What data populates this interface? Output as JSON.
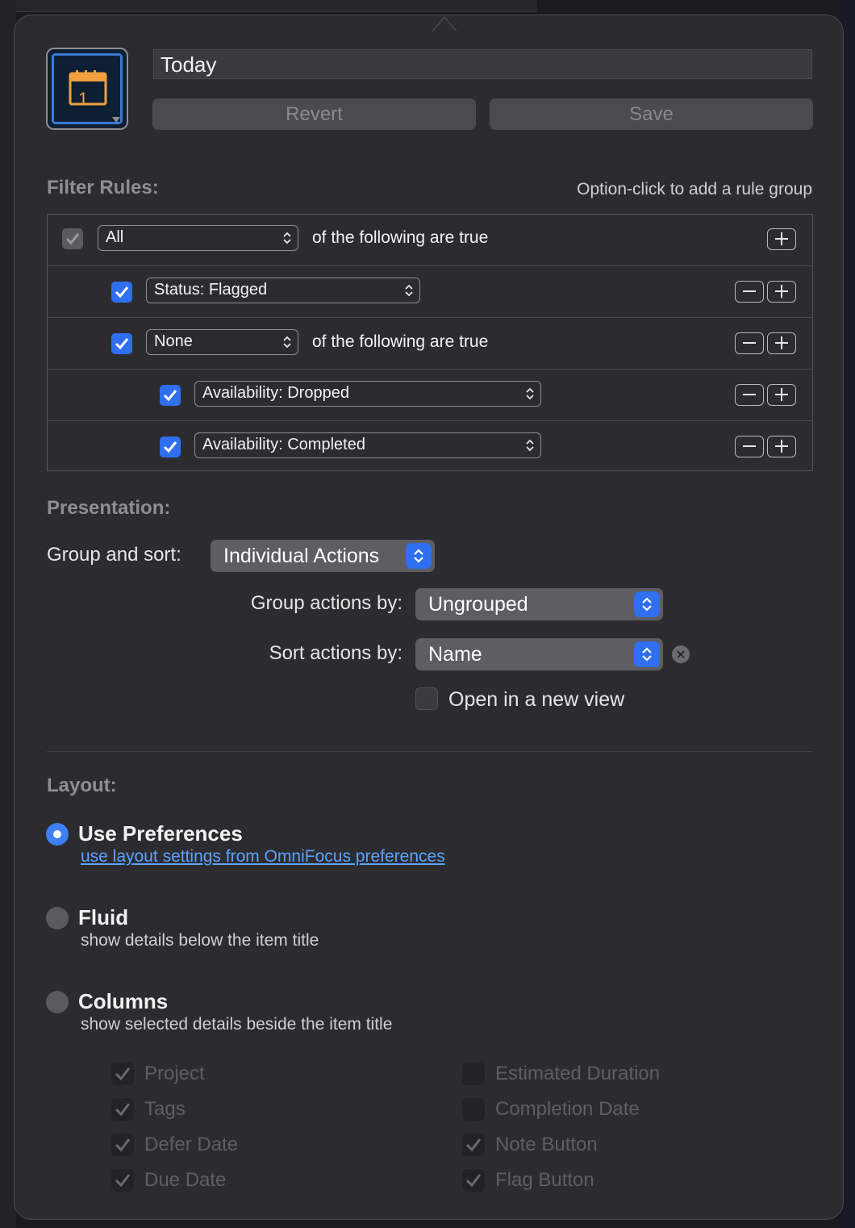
{
  "perspective": {
    "name": "Today",
    "revert_label": "Revert",
    "save_label": "Save",
    "icon": "calendar-icon",
    "icon_day": "1"
  },
  "filter_rules": {
    "title": "Filter Rules:",
    "hint": "Option-click to add a rule group",
    "rows": [
      {
        "select": "All",
        "suffix": "of the following are true",
        "checked": true
      },
      {
        "select": "Status: Flagged",
        "suffix": "",
        "checked": true
      },
      {
        "select": "None",
        "suffix": "of the following are true",
        "checked": true
      },
      {
        "select": "Availability: Dropped",
        "suffix": "",
        "checked": true
      },
      {
        "select": "Availability: Completed",
        "suffix": "",
        "checked": true
      }
    ]
  },
  "presentation": {
    "title": "Presentation:",
    "group_sort_label": "Group and sort:",
    "group_sort_value": "Individual Actions",
    "group_by_label": "Group actions by:",
    "group_by_value": "Ungrouped",
    "sort_by_label": "Sort actions by:",
    "sort_by_value": "Name",
    "new_view_label": "Open in a new view",
    "new_view_checked": false
  },
  "layout": {
    "title": "Layout:",
    "options": [
      {
        "title": "Use Preferences",
        "subtitle": "use layout settings from OmniFocus preferences",
        "selected": true
      },
      {
        "title": "Fluid",
        "subtitle": "show details below the item title",
        "selected": false
      },
      {
        "title": "Columns",
        "subtitle": "show selected details beside the item title",
        "selected": false
      }
    ],
    "columns_left": [
      {
        "label": "Project",
        "checked": true
      },
      {
        "label": "Tags",
        "checked": true
      },
      {
        "label": "Defer Date",
        "checked": true
      },
      {
        "label": "Due Date",
        "checked": true
      }
    ],
    "columns_right": [
      {
        "label": "Estimated Duration",
        "checked": false
      },
      {
        "label": "Completion Date",
        "checked": false
      },
      {
        "label": "Note Button",
        "checked": true
      },
      {
        "label": "Flag Button",
        "checked": true
      }
    ]
  },
  "colors": {
    "accent": "#2f6ff0",
    "panel": "#2c2c30",
    "link": "#5aa2ff",
    "calendar_orange": "#f0a040"
  }
}
